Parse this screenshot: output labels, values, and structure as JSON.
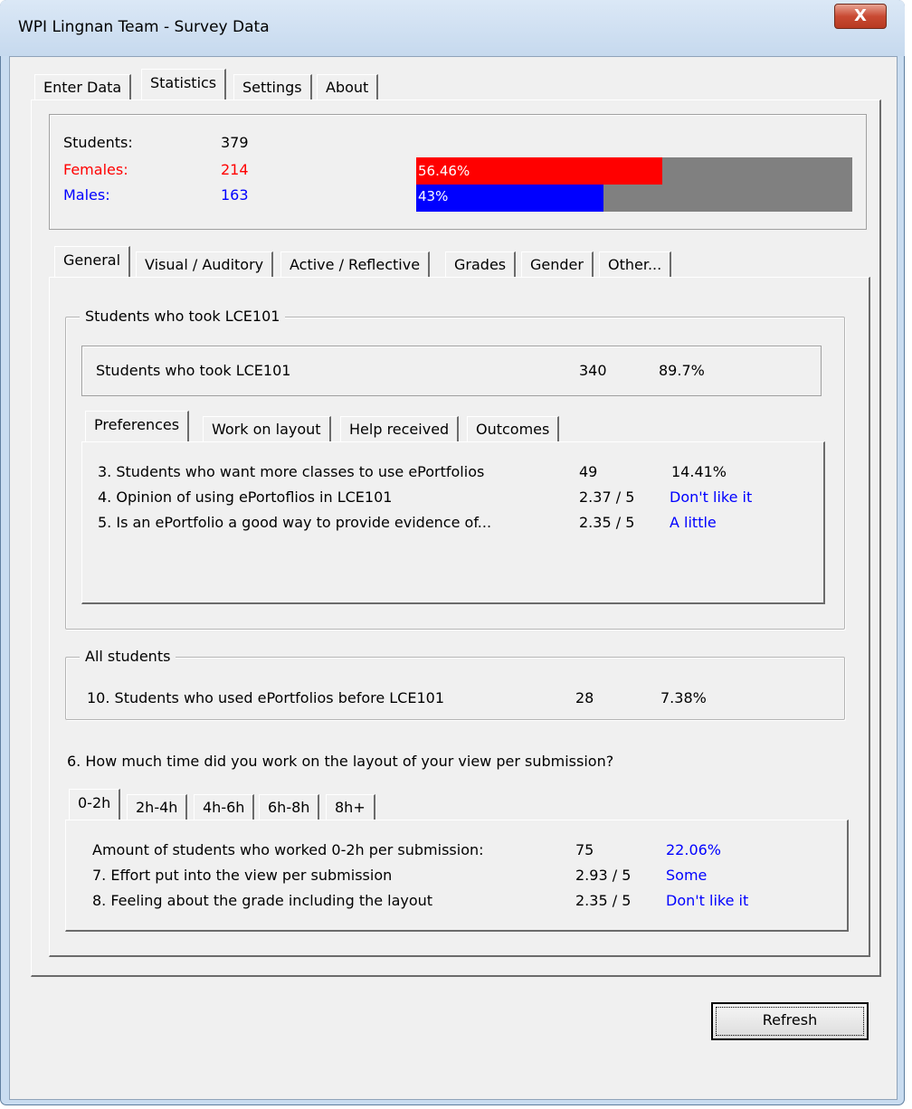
{
  "window": {
    "title": "WPI Lingnan Team - Survey Data",
    "close_label": "X"
  },
  "main_tabs": [
    "Enter Data",
    "Statistics",
    "Settings",
    "About"
  ],
  "summary": {
    "students_label": "Students:",
    "students_value": "379",
    "females_label": "Females:",
    "females_value": "214",
    "males_label": "Males:",
    "males_value": "163",
    "female_bar": {
      "label": "56.46%",
      "fraction": 0.5646,
      "color": "#ff0000"
    },
    "male_bar": {
      "label": "43%",
      "fraction": 0.43,
      "color": "#0000ff"
    },
    "bar_background": "#808080"
  },
  "stat_tabs": [
    "General",
    "Visual / Auditory",
    "Active / Reflective",
    "Grades",
    "Gender",
    "Other..."
  ],
  "lce101_group": {
    "title": "Students who took LCE101",
    "row": {
      "label": "Students who took LCE101",
      "value": "340",
      "percent": "89.7%"
    },
    "tabs": [
      "Preferences",
      "Work on layout",
      "Help received",
      "Outcomes"
    ],
    "rows": [
      {
        "label": "3. Students who want more classes to use ePortfolios",
        "value": "49",
        "extra": "14.41%"
      },
      {
        "label": "4. Opinion of using ePortoflios in LCE101",
        "value": "2.37 / 5",
        "extra": "Don't like it"
      },
      {
        "label": "5. Is an ePortfolio a good way to provide evidence of...",
        "value": "2.35 / 5",
        "extra": "A little"
      }
    ]
  },
  "all_students_group": {
    "title": "All students",
    "row": {
      "label": "10. Students who used ePortfolios before LCE101",
      "value": "28",
      "percent": "7.38%"
    }
  },
  "layout_question": {
    "text": "6. How much time did you work on the layout of your view per submission?",
    "tabs": [
      "0-2h",
      "2h-4h",
      "4h-6h",
      "6h-8h",
      "8h+"
    ],
    "rows": [
      {
        "label": "Amount of students who worked 0-2h per submission:",
        "value": "75",
        "extra": "22.06%"
      },
      {
        "label": "7. Effort put into the view per submission",
        "value": "2.93 / 5",
        "extra": "Some"
      },
      {
        "label": "8. Feeling about the grade including the layout",
        "value": "2.35 / 5",
        "extra": "Don't like it"
      }
    ]
  },
  "buttons": {
    "refresh": "Refresh"
  }
}
